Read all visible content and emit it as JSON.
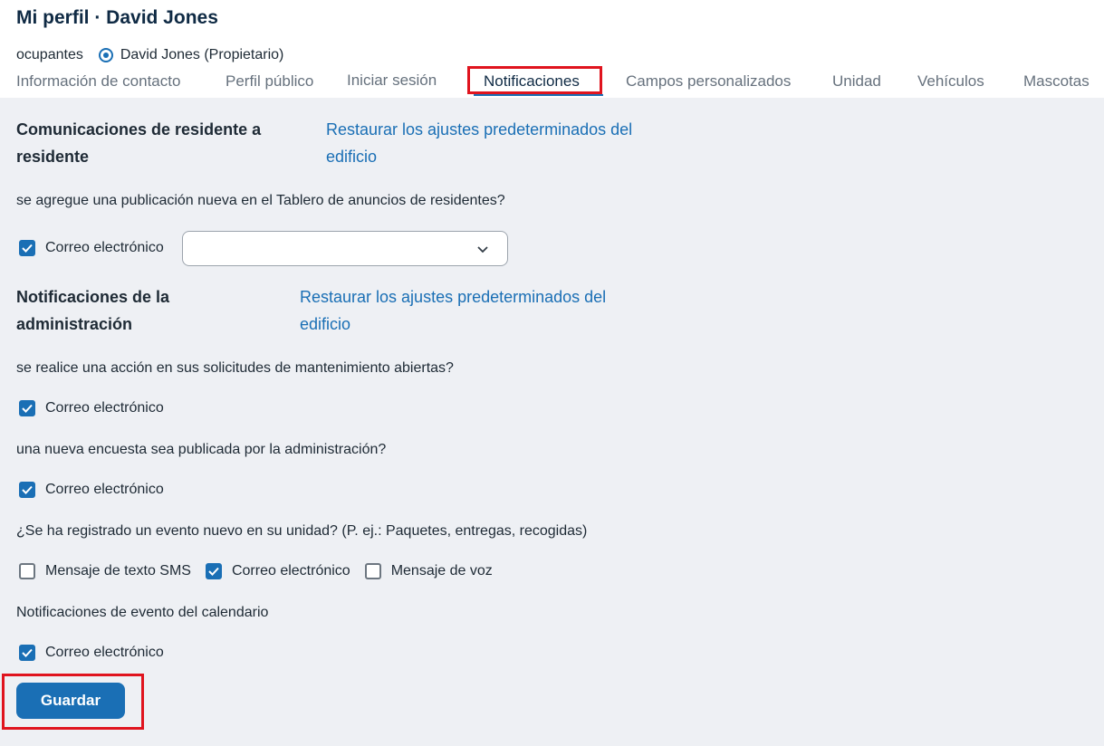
{
  "header": {
    "title": "Mi perfil · David Jones",
    "occupants_label": "ocupantes",
    "occupant_selected": "David Jones (Propietario)"
  },
  "tabs": [
    {
      "label": "Información de contacto",
      "active": false
    },
    {
      "label": "Perfil público",
      "active": false
    },
    {
      "label": "Iniciar sesión",
      "active": false
    },
    {
      "label": "Notificaciones",
      "active": true
    },
    {
      "label": "Campos personalizados",
      "active": false
    },
    {
      "label": "Unidad",
      "active": false
    },
    {
      "label": "Vehículos",
      "active": false
    },
    {
      "label": "Mascotas",
      "active": false
    }
  ],
  "sections": [
    {
      "title_line1": "Comunicaciones de residente a",
      "title_line2": "residente",
      "reset_line1": "Restaurar los ajustes predeterminados del",
      "reset_line2": "edificio",
      "questions": [
        {
          "text": "se agregue una publicación nueva en el Tablero de anuncios de residentes?",
          "options": [
            {
              "label": "Correo electrónico",
              "checked": true
            }
          ],
          "select": {
            "value": "",
            "icon": "chevron-down-icon"
          }
        }
      ]
    },
    {
      "title_line1": "Notificaciones de la",
      "title_line2": "administración",
      "reset_line1": "Restaurar los ajustes predeterminados del",
      "reset_line2": "edificio",
      "questions": [
        {
          "text": "se realice una acción en sus solicitudes de mantenimiento abiertas?",
          "options": [
            {
              "label": "Correo electrónico",
              "checked": true
            }
          ]
        },
        {
          "text": "una nueva encuesta sea publicada por la administración?",
          "options": [
            {
              "label": "Correo electrónico",
              "checked": true
            }
          ]
        },
        {
          "text": "¿Se ha registrado un evento nuevo en su unidad? (P. ej.: Paquetes, entregas, recogidas)",
          "options": [
            {
              "label": "Mensaje de texto SMS",
              "checked": false
            },
            {
              "label": "Correo electrónico",
              "checked": true
            },
            {
              "label": "Mensaje de voz",
              "checked": false
            }
          ]
        },
        {
          "text": "Notificaciones de evento del calendario",
          "options": [
            {
              "label": "Correo electrónico",
              "checked": true
            }
          ]
        }
      ]
    }
  ],
  "save_button": {
    "label": "Guardar"
  },
  "colors": {
    "accent": "#1a6fb5",
    "highlight": "#e0141e",
    "content_bg": "#eef0f4",
    "title": "#0f2a44"
  }
}
